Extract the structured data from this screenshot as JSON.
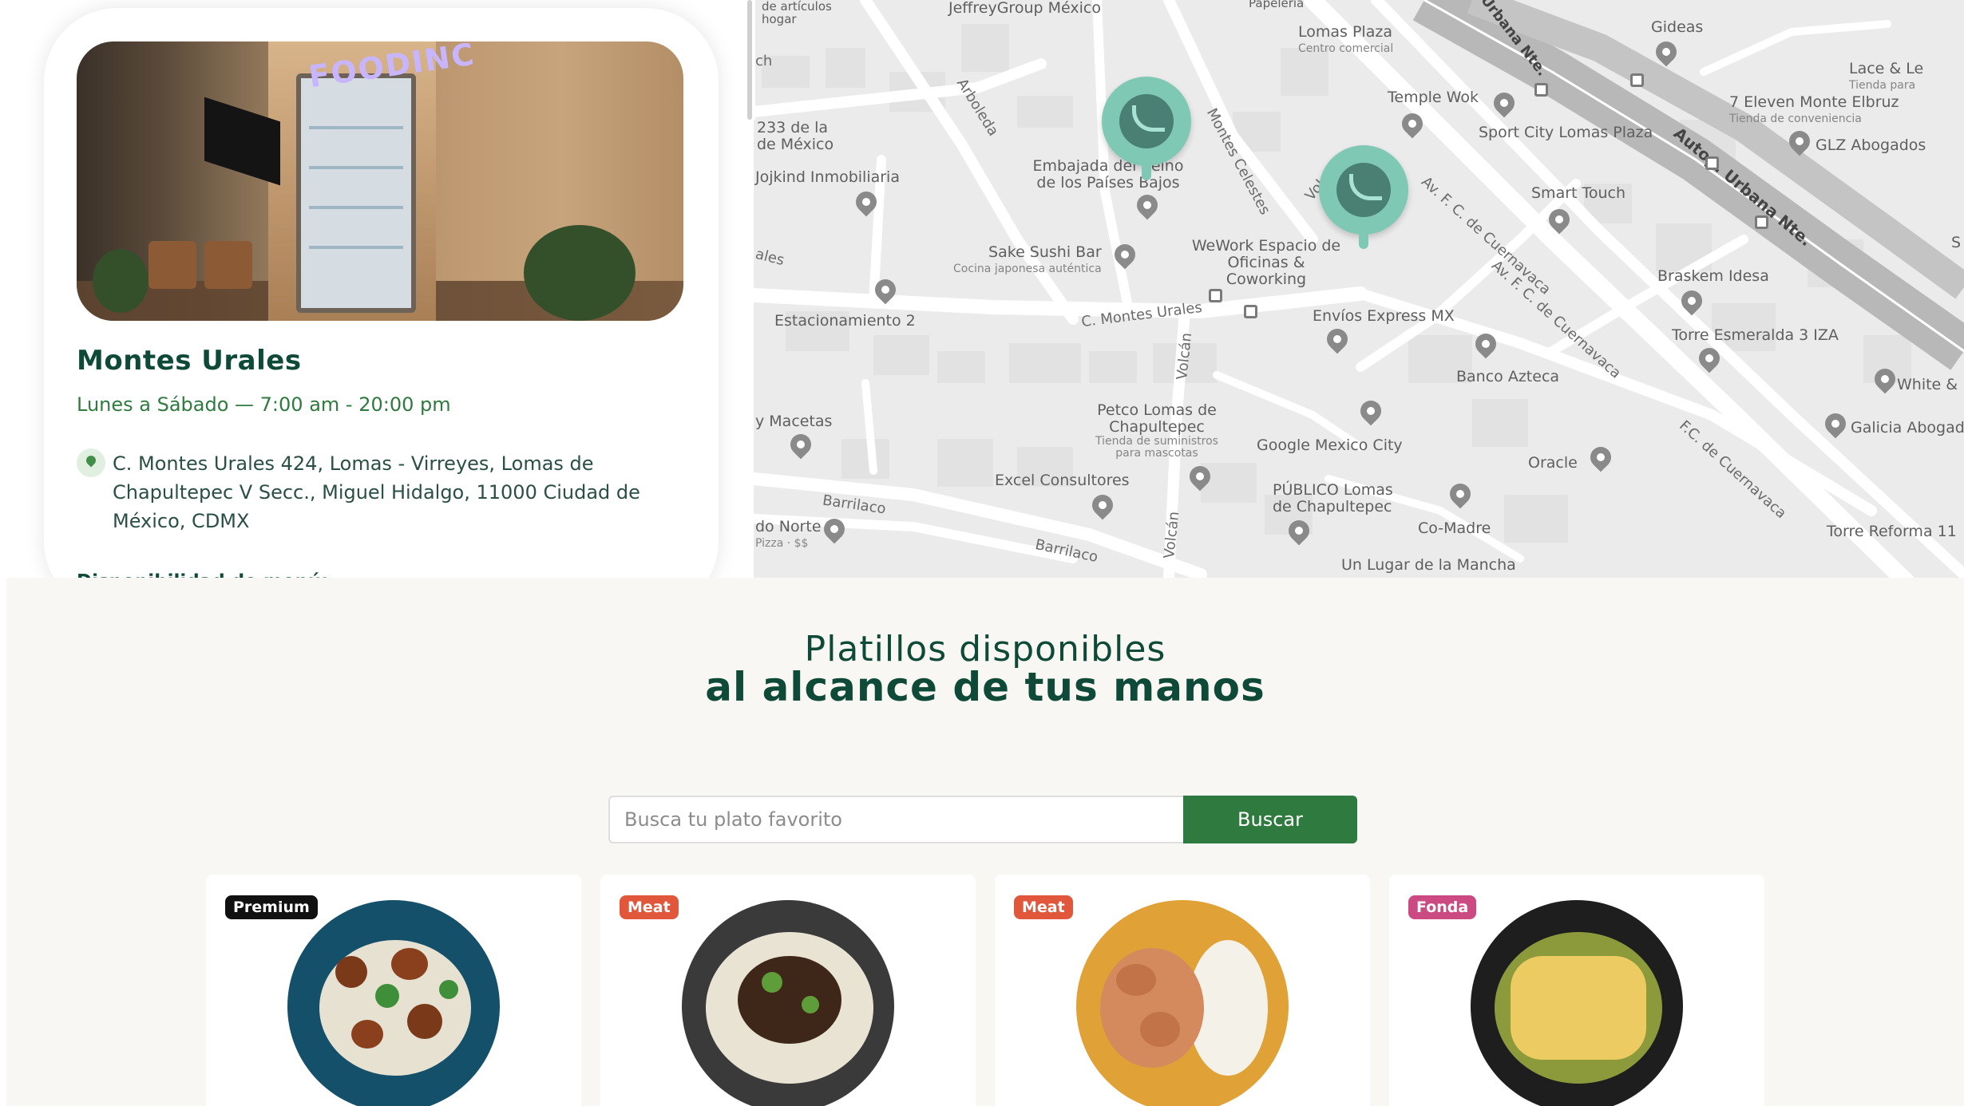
{
  "location": {
    "name": "Montes Urales",
    "hours": "Lunes a Sábado — 7:00 am - 20:00 pm",
    "address": "C. Montes Urales 424, Lomas - Virreyes, Lomas de Chapultepec V Secc., Miguel Hidalgo, 11000 Ciudad de México, CDMX",
    "menu_availability": "Disponibilidad de menú:",
    "photo_sign": "FOODINC"
  },
  "map": {
    "places": {
      "jeffrey": "JeffreyGroup México",
      "hogar": "de artículos hogar",
      "papeleria": "Papelería",
      "lomas_plaza": "Lomas Plaza",
      "lomas_plaza_sub": "Centro comercial",
      "gideas": "Gideas",
      "lace": "Lace & Le",
      "lace_sub": "Tienda para",
      "seven_eleven": "7 Eleven Monte Elbruz",
      "seven_eleven_sub": "Tienda de conveniencia",
      "temple_wok": "Temple Wok",
      "sport_city": "Sport City Lomas Plaza",
      "glz": "GLZ Abogados",
      "embajada": "Embajada del Reino de los Países Bajos",
      "mexico_233": "233 de la de México",
      "jojkind": "Jojkind Inmobiliaria",
      "smart_touch": "Smart Touch",
      "sake": "Sake Sushi Bar",
      "sake_sub": "Cocina japonesa auténtica",
      "wework": "WeWork Espacio de Oficinas & Coworking",
      "braskem": "Braskem Idesa",
      "torre_esmeralda": "Torre Esmeralda 3 IZA",
      "estacionamiento": "Estacionamiento 2",
      "envios": "Envíos Express MX",
      "banco_azteca": "Banco Azteca",
      "white": "White &",
      "galicia": "Galicia Abogad",
      "macetas": "y Macetas",
      "petco": "Petco Lomas de Chapultepec",
      "petco_sub": "Tienda de suministros para mascotas",
      "google": "Google Mexico City",
      "oracle": "Oracle",
      "excel": "Excel Consultores",
      "publico": "PÚBLICO Lomas de Chapultepec",
      "comadre": "Co-Madre",
      "do_norte": "do Norte",
      "do_norte_sub": "Pizza · $$",
      "torre_reforma": "Torre Reforma 11",
      "lugar_mancha": "Un Lugar de la Mancha",
      "s_edge": "S"
    },
    "streets": {
      "urbana_top": "p. Urbana Nte.",
      "urbana_right": "Autop. Urbana Nte.",
      "arboleda": "Arboleda",
      "montes_celestes": "Montes Celestes",
      "vol": "Vol",
      "cuernavaca_1": "Av. F. C. de Cuernavaca",
      "cuernavaca_2": "Av. F. C. de Cuernavaca",
      "cuernavaca_3": "F.C. de Cuernavaca",
      "montes_urales": "C. Montes Urales",
      "volcan_1": "Volcán",
      "volcan_2": "Volcán",
      "barrilaco_1": "Barrilaco",
      "barrilaco_2": "Barrilaco",
      "ch": "ch",
      "ales": "ales"
    }
  },
  "menu_section": {
    "title_line1": "Platillos disponibles",
    "title_line2": "al alcance de tus manos",
    "search_placeholder": "Busca tu plato favorito",
    "search_button": "Buscar",
    "dishes": [
      {
        "badge": "Premium",
        "badge_color": "#111111",
        "plate_color": "#14506a"
      },
      {
        "badge": "Meat",
        "badge_color": "#e0573c",
        "plate_color": "#3a3a3a"
      },
      {
        "badge": "Meat",
        "badge_color": "#e0573c",
        "plate_color": "#e0a236"
      },
      {
        "badge": "Fonda",
        "badge_color": "#cc4a82",
        "plate_color": "#1e1e1e"
      }
    ]
  },
  "colors": {
    "brand_dark": "#0f4a38",
    "brand_green": "#2f7a3e",
    "marker": "#7fc8b4"
  }
}
